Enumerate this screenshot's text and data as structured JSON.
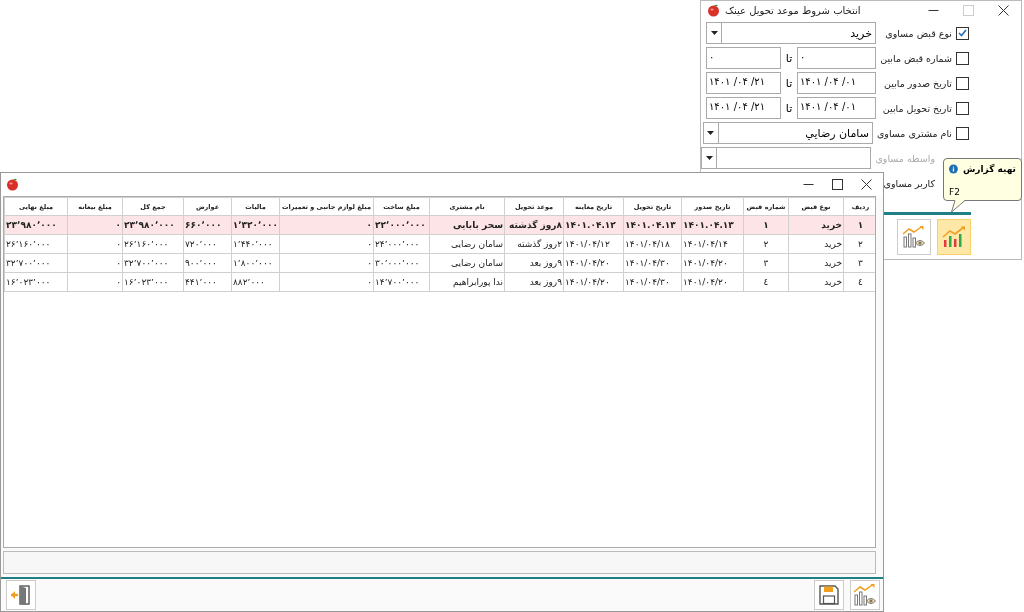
{
  "filter_dialog": {
    "title": "انتخاب شروط موعد تحویل عینک",
    "rows": [
      {
        "label": "نوع قبض مساوی",
        "checked": true,
        "disabled": false,
        "field": {
          "kind": "combo",
          "value": "خرید"
        }
      },
      {
        "label": "شماره قبض مابین",
        "checked": false,
        "disabled": false,
        "field": {
          "kind": "range",
          "from": "۰",
          "separator": "تا",
          "to": "۰"
        }
      },
      {
        "label": "تاریخ صدور مابین",
        "checked": false,
        "disabled": false,
        "field": {
          "kind": "range",
          "from": "۱۴۰۱ /۰۴ /۰۱",
          "separator": "تا",
          "to": "۱۴۰۱ /۰۴ /۲۱"
        }
      },
      {
        "label": "تاریخ تحویل مابین",
        "checked": false,
        "disabled": false,
        "field": {
          "kind": "range",
          "from": "۱۴۰۱ /۰۴ /۰۱",
          "separator": "تا",
          "to": "۱۴۰۱ /۰۴ /۲۱"
        }
      },
      {
        "label": "نام مشتری مساوی",
        "checked": false,
        "disabled": false,
        "field": {
          "kind": "combo",
          "value": "سامان رضایي"
        }
      },
      {
        "label": "واسطه مساوی",
        "disabled": true,
        "field": {
          "kind": "combo"
        }
      },
      {
        "label": "کاربر مساوی",
        "disabled": false
      }
    ],
    "tooltip": {
      "title": "تهیه گزارش",
      "shortcut": "F2"
    },
    "buttons": [
      {
        "kind": "report",
        "highlighted": true
      },
      {
        "kind": "report-preview",
        "highlighted": false
      }
    ]
  },
  "report_window": {
    "columns": [
      "ردیف",
      "نوع قبض",
      "شماره قبض",
      "تاریخ صدور",
      "تاریخ تحویل",
      "تاریخ معاینه",
      "موعد تحویل",
      "نام مشتری",
      "مبلغ ساخت",
      "مبلغ لوازم جانبی و تعمیرات",
      "مالیات",
      "عوارض",
      "جمع کل",
      "مبلغ بیعانه",
      "مبلغ نهایی"
    ],
    "rows": [
      {
        "selected": true,
        "cells": [
          "۱",
          "خرید",
          "۱",
          "۱۴۰۱.۰۴.۱۳",
          "۱۴۰۱.۰۴.۱۳",
          "۱۴۰۱.۰۴.۱۲",
          "۸روز گذشته",
          "سحر بابایی",
          "۲۲٬۰۰۰٬۰۰۰",
          "۰",
          "۱٬۳۲۰٬۰۰۰",
          "۶۶۰٬۰۰۰",
          "۲۳٬۹۸۰٬۰۰۰",
          "۰",
          "۲۳٬۹۸۰٬۰۰۰"
        ]
      },
      {
        "selected": false,
        "cells": [
          "۲",
          "خرید",
          "۲",
          "۱۴۰۱/۰۴/۱۴",
          "۱۴۰۱/۰۴/۱۸",
          "۱۴۰۱/۰۴/۱۲",
          "۲روز گذشته",
          "سامان رضایی",
          "۲۴٬۰۰۰٬۰۰۰",
          "۰",
          "۱٬۴۴۰٬۰۰۰",
          "۷۲۰٬۰۰۰",
          "۲۶٬۱۶۰٬۰۰۰",
          "۰",
          "۲۶٬۱۶۰٬۰۰۰"
        ]
      },
      {
        "selected": false,
        "cells": [
          "۳",
          "خرید",
          "۳",
          "۱۴۰۱/۰۴/۲۰",
          "۱۴۰۱/۰۴/۳۰",
          "۱۴۰۱/۰۴/۲۰",
          "۹روز بعد",
          "سامان رضایی",
          "۳۰٬۰۰۰٬۰۰۰",
          "۰",
          "۱٬۸۰۰٬۰۰۰",
          "۹۰۰٬۰۰۰",
          "۳۲٬۷۰۰٬۰۰۰",
          "۰",
          "۳۲٬۷۰۰٬۰۰۰"
        ]
      },
      {
        "selected": false,
        "cells": [
          "٤",
          "خرید",
          "٤",
          "۱۴۰۱/۰۴/۲۰",
          "۱۴۰۱/۰۴/۳۰",
          "۱۴۰۱/۰۴/۲۰",
          "۹روز بعد",
          "ندا پورابراهیم",
          "۱۴٬۷۰۰٬۰۰۰",
          "۰",
          "۸۸۲٬۰۰۰",
          "۴۴۱٬۰۰۰",
          "۱۶٬۰۲۳٬۰۰۰",
          "۰",
          "۱۶٬۰۲۳٬۰۰۰"
        ]
      }
    ],
    "bottom_buttons": [
      {
        "kind": "exit"
      },
      {
        "kind": "save"
      },
      {
        "kind": "report-preview"
      }
    ]
  }
}
